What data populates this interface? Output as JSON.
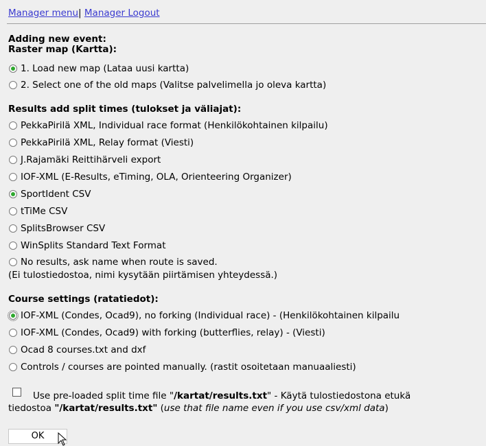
{
  "nav": {
    "manager_menu": "Manager menu",
    "separator": "|",
    "logout": "Manager Logout"
  },
  "headings": {
    "adding": "Adding new event:",
    "raster": "Raster map (Kartta):",
    "results": "Results add split times (tulokset ja väliajat):",
    "course": "Course settings (ratatiedot):"
  },
  "map_options": [
    {
      "label": "1. Load new map (Lataa uusi kartta)",
      "checked": true
    },
    {
      "label": "2. Select one of the old maps (Valitse palvelimella jo oleva kartta)",
      "checked": false
    }
  ],
  "results_options": [
    {
      "label": "PekkaPirilä XML, Individual race format (Henkilökohtainen kilpailu)",
      "checked": false
    },
    {
      "label": "PekkaPirilä XML, Relay format (Viesti)",
      "checked": false
    },
    {
      "label": "J.Rajamäki Reittihärveli export",
      "checked": false
    },
    {
      "label": "IOF-XML (E-Results, eTiming, OLA, Orienteering Organizer)",
      "checked": false
    },
    {
      "label": "SportIdent CSV",
      "checked": true
    },
    {
      "label": "tTiMe CSV",
      "checked": false
    },
    {
      "label": "SplitsBrowser CSV",
      "checked": false
    },
    {
      "label": "WinSplits Standard Text Format",
      "checked": false
    },
    {
      "label": "No results, ask name when route is saved.",
      "checked": false
    }
  ],
  "results_note": "(Ei tulostiedostoa, nimi kysytään piirtämisen yhteydessä.)",
  "course_options": [
    {
      "label": "IOF-XML (Condes, Ocad9), no forking (Individual race) - (Henkilökohtainen kilpailu",
      "checked": true
    },
    {
      "label": "IOF-XML (Condes, Ocad9) with forking (butterflies, relay) - (Viesti)",
      "checked": false
    },
    {
      "label": "Ocad 8 courses.txt and dxf",
      "checked": false
    },
    {
      "label": "Controls / courses are pointed manually. (rastit osoitetaan manuaaliesti)",
      "checked": false
    }
  ],
  "preload": {
    "t1": "Use pre-loaded split time file \"",
    "file1": "/kartat/results.txt",
    "t2": "\" - Käytä tulostiedostona etukä",
    "t3": "tiedostoa ",
    "file2": "\"/kartat/results.txt\"",
    "t4": " (",
    "note": "use that file name even if you use csv/xml data",
    "t5": ")"
  },
  "ok_label": "OK"
}
